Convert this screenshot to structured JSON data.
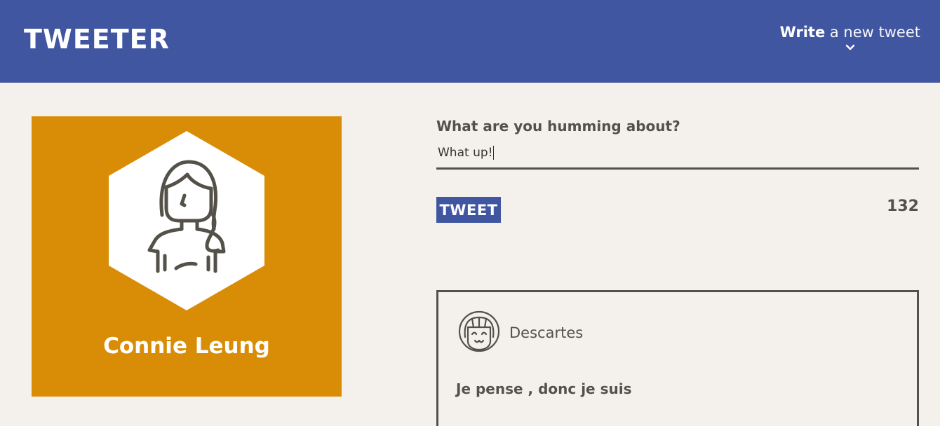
{
  "navbar": {
    "logo": "TWEETER",
    "compose_strong": "Write",
    "compose_light": " a new tweet",
    "chevron_icon": "chevron-down-icon",
    "background": "#4056a1"
  },
  "profile": {
    "name": "Connie Leung",
    "avatar_icon": "female-user-icon",
    "background": "#d98c05"
  },
  "composer": {
    "prompt": "What are you humming about?",
    "input_value": "What up!",
    "button_label": "TWEET",
    "char_count": "132"
  },
  "tweets": [
    {
      "author": "Descartes",
      "avatar_icon": "smiling-girl-icon",
      "text": "Je pense , donc je suis"
    }
  ]
}
